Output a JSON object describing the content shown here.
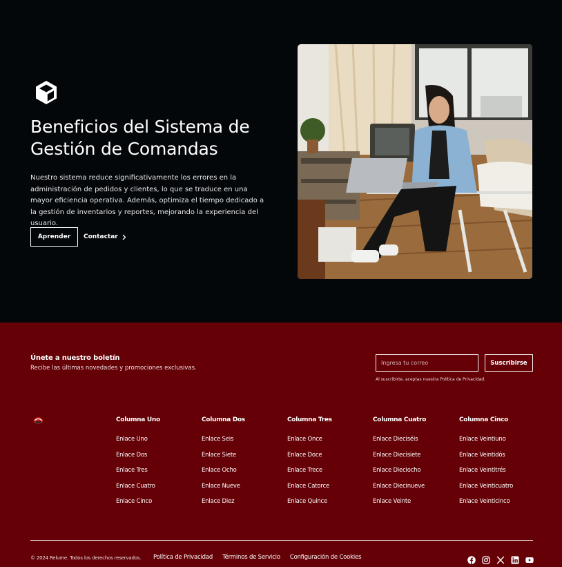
{
  "hero": {
    "icon": "cube-icon",
    "title": "Beneficios del Sistema de Gestión de Comandas",
    "description": "Nuestro sistema reduce significativamente los errores en la administración de pedidos y clientes, lo que se traduce en una mayor eficiencia operativa. Además, optimiza el tiempo dedicado a la gestión de inventarios y reportes, mejorando la experiencia del usuario.",
    "primary_button": "Aprender",
    "secondary_button": "Contactar",
    "photo": "woman-with-laptop-photo"
  },
  "newsletter": {
    "title": "Únete a nuestro boletín",
    "subtitle": "Recibe las últimas novedades y promociones exclusivas.",
    "placeholder": "Ingresa tu correo",
    "button": "Suscribirse",
    "note": "Al suscribirte, aceptas nuestra Política de Privacidad."
  },
  "columns": [
    {
      "title": "Columna Uno",
      "links": [
        "Enlace Uno",
        "Enlace Dos",
        "Enlace Tres",
        "Enlace Cuatro",
        "Enlace Cinco"
      ]
    },
    {
      "title": "Columna Dos",
      "links": [
        "Enlace Seis",
        "Enlace Siete",
        "Enlace Ocho",
        "Enlace Nueve",
        "Enlace Diez"
      ]
    },
    {
      "title": "Columna Tres",
      "links": [
        "Enlace Once",
        "Enlace Doce",
        "Enlace Trece",
        "Enlace Catorce",
        "Enlace Quince"
      ]
    },
    {
      "title": "Columna Cuatro",
      "links": [
        "Enlace Dieciséis",
        "Enlace Diecisiete",
        "Enlace Dieciocho",
        "Enlace Diecinueve",
        "Enlace Veinte"
      ]
    },
    {
      "title": "Columna Cinco",
      "links": [
        "Enlace Veintiuno",
        "Enlace Veintidós",
        "Enlace Veintitrés",
        "Enlace Veinticuatro",
        "Enlace Veinticinco"
      ]
    }
  ],
  "bottom": {
    "copyright": "© 2024 Relume. Todos los derechos reservados.",
    "legal": [
      "Política de Privacidad",
      "Términos de Servicio",
      "Configuración de Cookies"
    ],
    "socials": [
      "facebook-icon",
      "instagram-icon",
      "x-icon",
      "linkedin-icon",
      "youtube-icon"
    ]
  },
  "colors": {
    "hero_bg": "#04070a",
    "footer_bg": "#640006",
    "text": "#ffffff"
  }
}
